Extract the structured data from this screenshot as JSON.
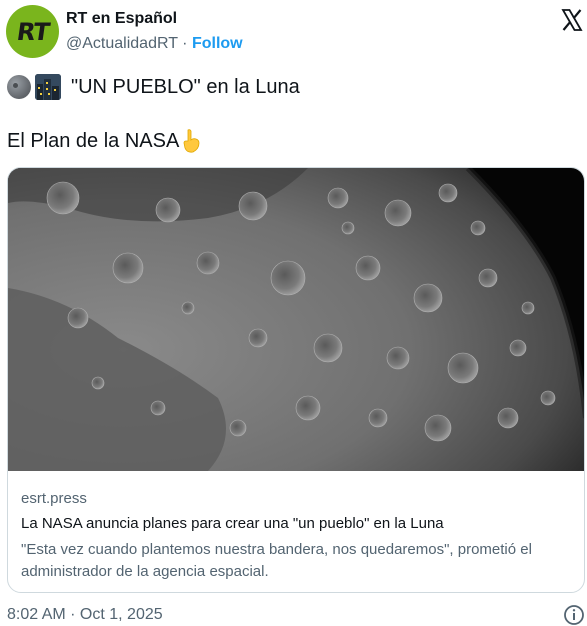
{
  "author": {
    "avatar_text": "RT",
    "name": "RT en Español",
    "handle": "@ActualidadRT",
    "separator": "·",
    "follow_label": "Follow"
  },
  "tweet": {
    "line1": "\"UN PUEBLO\" en la Luna",
    "line2": "El Plan de la NASA",
    "icons": [
      "moon-emoji",
      "city-emoji",
      "pointing-down-emoji"
    ]
  },
  "card": {
    "domain": "esrt.press",
    "title": "La NASA anuncia planes para crear una \"un pueblo\" en la Luna",
    "description": "\"Esta vez cuando plantemos nuestra bandera, nos quedaremos\", prometió el administrador de la agencia espacial."
  },
  "meta": {
    "timestamp": "8:02 AM · Oct 1, 2025"
  },
  "colors": {
    "brand_green": "#7ab51d",
    "link_blue": "#1d9bf0",
    "secondary_text": "#536471"
  }
}
